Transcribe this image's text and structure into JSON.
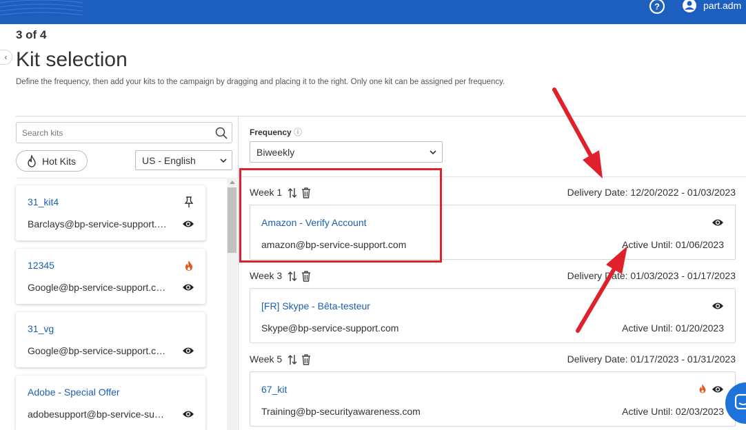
{
  "header": {
    "username": "part.adm",
    "help_icon": "help-circle-icon",
    "user_icon": "user-account-icon",
    "brand_color": "#1d5fbf"
  },
  "page": {
    "step": "3 of 4",
    "title": "Kit selection",
    "description": "Define the frequency, then add your kits to the campaign by dragging and placing it to the right. Only one kit can be assigned per frequency."
  },
  "left_panel": {
    "search_placeholder": "Search kits",
    "hot_kits_label": "Hot Kits",
    "language_selected": "US - English",
    "kits": [
      {
        "name": "31_kit4",
        "email": "Barclays@bp-service-support.com",
        "icon": "pin-icon"
      },
      {
        "name": "12345",
        "email": "Google@bp-service-support.com",
        "icon": "fire-icon"
      },
      {
        "name": "31_vg",
        "email": "Google@bp-service-support.com",
        "icon": ""
      },
      {
        "name": "Adobe - Special Offer",
        "email": "adobesupport@bp-service-support.com",
        "icon": ""
      }
    ]
  },
  "right_panel": {
    "frequency_label": "Frequency",
    "frequency_info_glyph": "ⓘ",
    "frequency_selected": "Biweekly",
    "weeks": [
      {
        "label": "Week 1",
        "delivery": "Delivery Date: 12/20/2022 - 01/03/2023",
        "kit": {
          "name": "Amazon - Verify Account",
          "email": "amazon@bp-service-support.com",
          "active": "Active Until: 01/06/2023",
          "hot": false
        }
      },
      {
        "label": "Week 3",
        "delivery": "Delivery Date: 01/03/2023 - 01/17/2023",
        "kit": {
          "name": "[FR] Skype - Bêta-testeur",
          "email": "Skype@bp-service-support.com",
          "active": "Active Until: 01/20/2023",
          "hot": false
        }
      },
      {
        "label": "Week 5",
        "delivery": "Delivery Date: 01/17/2023 - 01/31/2023",
        "kit": {
          "name": "67_kit",
          "email": "Training@bp-securityawareness.com",
          "active": "Active Until: 02/03/2023",
          "hot": true
        }
      }
    ]
  },
  "annotation_color": "#e0202a",
  "link_color": "#1a5fb4"
}
